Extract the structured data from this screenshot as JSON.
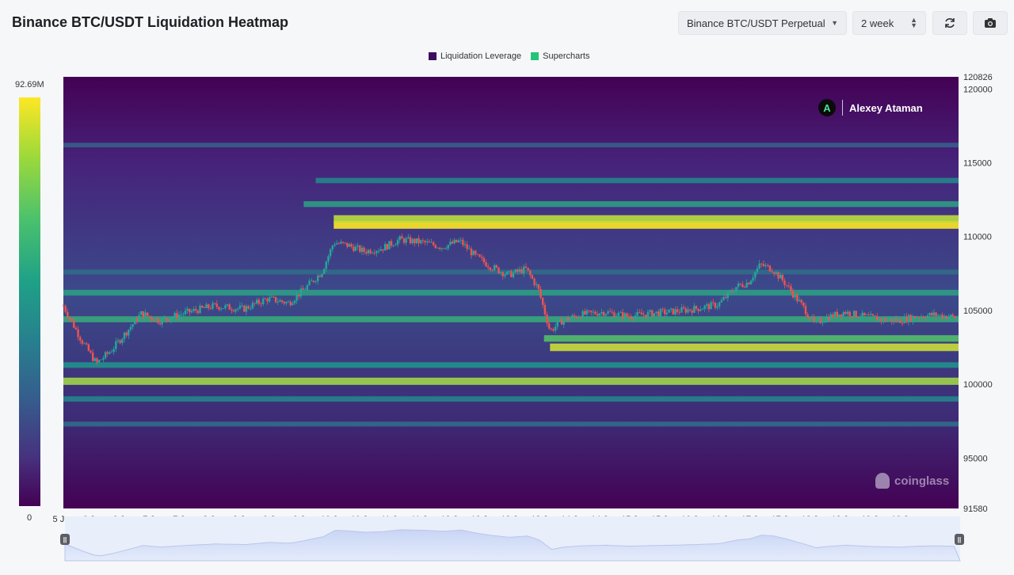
{
  "header": {
    "title": "Binance BTC/USDT Liquidation Heatmap",
    "exchange_select": "Binance BTC/USDT Perpetual",
    "range_select": "2 week",
    "refresh_icon": "refresh-icon",
    "camera_icon": "camera-icon"
  },
  "legend": {
    "items": [
      {
        "label": "Liquidation Leverage",
        "color": "#3b0d5e"
      },
      {
        "label": "Supercharts",
        "color": "#22c47a"
      }
    ]
  },
  "colorbar": {
    "max_label": "92.69M",
    "min_label": "0"
  },
  "watermark": {
    "author": "Alexey Ataman",
    "brand": "coinglass"
  },
  "colors": {
    "heat_low": "#440154",
    "heat_mid": "#21918c",
    "heat_high": "#fde725",
    "candle_up": "#26a69a",
    "candle_down": "#ef5350",
    "navigator_fill": "#d9e2f7"
  },
  "chart_data": {
    "type": "heatmap",
    "title": "Binance BTC/USDT Liquidation Heatmap",
    "x_tick_labels": [
      "5 Jun",
      "6 Jun",
      "6 Jun",
      "7 Jun",
      "7 Jun",
      "8 Jun",
      "8 Jun",
      "9 Jun",
      "9 Jun",
      "10 Jun",
      "10 Jun",
      "11 Jun",
      "11 Jun",
      "12 Jun",
      "12 Jun",
      "13 Jun",
      "13 Jun",
      "14 Jun",
      "14 Jun",
      "15 Jun",
      "15 Jun",
      "16 Jun",
      "16 Jun",
      "17 Jun",
      "17 Jun",
      "18 Jun",
      "18 Jun",
      "19 Jun",
      "19 Jun"
    ],
    "x_range": [
      5,
      19.9
    ],
    "y_tick_labels": [
      "120826",
      "120000",
      "115000",
      "110000",
      "105000",
      "100000",
      "95000",
      "91580"
    ],
    "y_range": [
      91580,
      120826
    ],
    "colorbar_range": [
      0,
      92690000
    ],
    "price_path": [
      [
        5.0,
        105300
      ],
      [
        5.3,
        103000
      ],
      [
        5.55,
        101400
      ],
      [
        5.8,
        102300
      ],
      [
        6.1,
        103800
      ],
      [
        6.3,
        104800
      ],
      [
        6.6,
        104300
      ],
      [
        7.0,
        104800
      ],
      [
        7.5,
        105300
      ],
      [
        8.0,
        105100
      ],
      [
        8.4,
        105800
      ],
      [
        8.75,
        105500
      ],
      [
        9.0,
        106400
      ],
      [
        9.3,
        107600
      ],
      [
        9.5,
        109600
      ],
      [
        9.75,
        109400
      ],
      [
        10.0,
        109000
      ],
      [
        10.3,
        109200
      ],
      [
        10.6,
        109800
      ],
      [
        11.0,
        109600
      ],
      [
        11.3,
        109300
      ],
      [
        11.6,
        109700
      ],
      [
        11.85,
        108700
      ],
      [
        12.1,
        108000
      ],
      [
        12.4,
        107400
      ],
      [
        12.7,
        107800
      ],
      [
        12.9,
        106500
      ],
      [
        13.1,
        103600
      ],
      [
        13.3,
        104300
      ],
      [
        13.6,
        104700
      ],
      [
        14.0,
        104900
      ],
      [
        14.4,
        104600
      ],
      [
        14.8,
        104800
      ],
      [
        15.1,
        104900
      ],
      [
        15.5,
        105100
      ],
      [
        15.9,
        105400
      ],
      [
        16.2,
        106600
      ],
      [
        16.4,
        106900
      ],
      [
        16.6,
        108100
      ],
      [
        16.8,
        107800
      ],
      [
        17.0,
        106900
      ],
      [
        17.3,
        105300
      ],
      [
        17.5,
        104100
      ],
      [
        17.7,
        104500
      ],
      [
        18.0,
        104900
      ],
      [
        18.3,
        104600
      ],
      [
        18.6,
        104400
      ],
      [
        18.9,
        104300
      ],
      [
        19.2,
        104600
      ],
      [
        19.5,
        104700
      ],
      [
        19.9,
        104500
      ]
    ],
    "liquidation_bands": [
      {
        "price": 110800,
        "from": 9.5,
        "intensity": 1.0
      },
      {
        "price": 111200,
        "from": 9.5,
        "intensity": 0.9
      },
      {
        "price": 102500,
        "from": 13.1,
        "intensity": 0.92
      },
      {
        "price": 100200,
        "from": 5.0,
        "intensity": 0.85
      },
      {
        "price": 104400,
        "from": 5.0,
        "intensity": 0.6
      },
      {
        "price": 103100,
        "from": 13.0,
        "intensity": 0.7
      },
      {
        "price": 113800,
        "from": 9.2,
        "intensity": 0.45
      },
      {
        "price": 112200,
        "from": 9.0,
        "intensity": 0.55
      },
      {
        "price": 106200,
        "from": 5.0,
        "intensity": 0.55
      },
      {
        "price": 101300,
        "from": 5.0,
        "intensity": 0.5
      },
      {
        "price": 99000,
        "from": 5.0,
        "intensity": 0.45
      },
      {
        "price": 97300,
        "from": 5.0,
        "intensity": 0.35
      },
      {
        "price": 116200,
        "from": 5.0,
        "intensity": 0.3
      },
      {
        "price": 107600,
        "from": 5.0,
        "intensity": 0.35
      }
    ],
    "legend_position": "top-center",
    "grid": false
  }
}
